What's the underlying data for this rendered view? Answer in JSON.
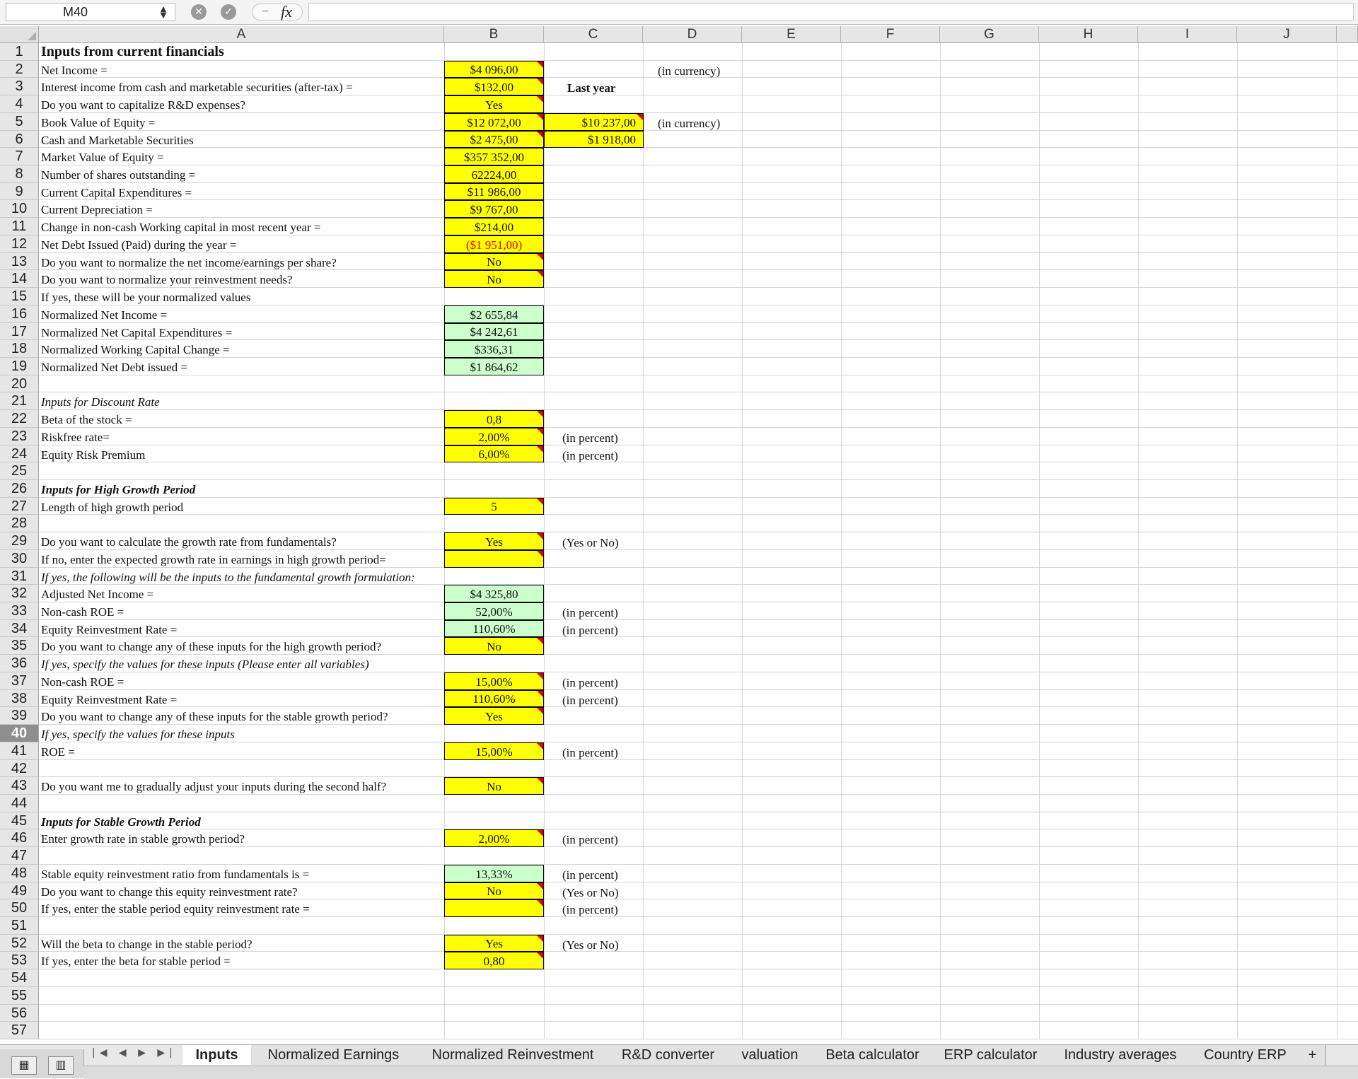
{
  "formula_bar": {
    "name_box": "M40",
    "fx": "fx"
  },
  "columns": [
    "A",
    "B",
    "C",
    "D",
    "E",
    "F",
    "G",
    "H",
    "I",
    "J"
  ],
  "rows": [
    {
      "n": "1",
      "a": "Inputs from current financials",
      "style": "bold"
    },
    {
      "n": "2",
      "a": "Net Income =",
      "b": "$4 096,00",
      "b_mark": true,
      "d": "(in currency)"
    },
    {
      "n": "3",
      "a": "Interest income from cash and marketable securities (after-tax) =",
      "b": "$132,00",
      "b_mark": true,
      "c_label": "Last year"
    },
    {
      "n": "4",
      "a": "Do you want to capitalize R&D expenses?",
      "b": "Yes",
      "b_mark": true
    },
    {
      "n": "5",
      "a": "Book Value of Equity =",
      "b": "$12 072,00",
      "b_mark": true,
      "c": "$10 237,00",
      "c_mark": true,
      "d": "(in currency)"
    },
    {
      "n": "6",
      "a": "Cash and Marketable Securities",
      "b": "$2 475,00",
      "b_mark": true,
      "c": "$1 918,00"
    },
    {
      "n": "7",
      "a": "Market Value of Equity =",
      "b": "$357 352,00"
    },
    {
      "n": "8",
      "a": "Number of shares outstanding =",
      "b": "62224,00"
    },
    {
      "n": "9",
      "a": "Current Capital Expenditures =",
      "b": "$11 986,00"
    },
    {
      "n": "10",
      "a": "Current Depreciation =",
      "b": "$9 767,00"
    },
    {
      "n": "11",
      "a": "Change in non-cash Working capital in most recent year =",
      "b": "$214,00"
    },
    {
      "n": "12",
      "a": "Net Debt Issued (Paid) during the year =",
      "b": "($1 951,00)",
      "b_red": true
    },
    {
      "n": "13",
      "a": "Do you want to normalize the net income/earnings per share?",
      "b": "No",
      "b_mark": true
    },
    {
      "n": "14",
      "a": "Do you want to normalize your reinvestment needs?",
      "b": "No",
      "b_mark": true
    },
    {
      "n": "15",
      "a": "If yes, these will be your normalized values"
    },
    {
      "n": "16",
      "a": "Normalized Net Income =",
      "b": "$2 655,84",
      "b_green": true
    },
    {
      "n": "17",
      "a": "Normalized Net Capital Expenditures =",
      "b": "$4 242,61",
      "b_green": true
    },
    {
      "n": "18",
      "a": "Normalized Working Capital Change =",
      "b": "$336,31",
      "b_green": true
    },
    {
      "n": "19",
      "a": "Normalized Net Debt issued =",
      "b": "$1 864,62",
      "b_green": true
    },
    {
      "n": "20"
    },
    {
      "n": "21",
      "a": "Inputs for Discount Rate",
      "style": "ital"
    },
    {
      "n": "22",
      "a": "Beta of the stock =",
      "b": "0,8",
      "b_mark": true
    },
    {
      "n": "23",
      "a": "Riskfree rate=",
      "b": "2,00%",
      "b_mark": true,
      "c": "(in percent)",
      "c_note": true
    },
    {
      "n": "24",
      "a": "Equity Risk Premium",
      "b": "6,00%",
      "b_mark": true,
      "c": "(in percent)",
      "c_note": true
    },
    {
      "n": "25"
    },
    {
      "n": "26",
      "a": "Inputs for High Growth Period",
      "style": "bi"
    },
    {
      "n": "27",
      "a": "Length of high growth period",
      "b": "5",
      "b_mark": true
    },
    {
      "n": "28"
    },
    {
      "n": "29",
      "a": "Do you want to calculate the growth rate from fundamentals?",
      "b": "Yes",
      "b_mark": true,
      "c": "(Yes or No)",
      "c_note": true
    },
    {
      "n": "30",
      "a": "If no, enter the expected growth rate in earnings in high growth period=",
      "b": "",
      "b_mark": true
    },
    {
      "n": "31",
      "a": "If yes, the following will be the inputs to the fundamental growth formulation:",
      "style": "ital"
    },
    {
      "n": "32",
      "a": "Adjusted Net Income =",
      "b": "$4 325,80",
      "b_green": true
    },
    {
      "n": "33",
      "a": "Non-cash ROE =",
      "b": "52,00%",
      "b_green": true,
      "c": "(in percent)",
      "c_note": true
    },
    {
      "n": "34",
      "a": "Equity Reinvestment Rate =",
      "b": "110,60%",
      "b_green": true,
      "c": "(in percent)",
      "c_note": true
    },
    {
      "n": "35",
      "a": "Do you want to change any of these inputs for the high growth period?",
      "b": "No",
      "b_mark": true
    },
    {
      "n": "36",
      "a": "If yes, specify the values for these inputs (Please enter all variables)",
      "style": "ital"
    },
    {
      "n": "37",
      "a": "Non-cash ROE =",
      "b": "15,00%",
      "b_mark": true,
      "c": "(in percent)",
      "c_note": true
    },
    {
      "n": "38",
      "a": "Equity Reinvestment Rate =",
      "b": "110,60%",
      "b_mark": true,
      "c": "(in percent)",
      "c_note": true
    },
    {
      "n": "39",
      "a": "Do you want to change any of these inputs for the stable growth period?",
      "b": "Yes",
      "b_mark": true
    },
    {
      "n": "40",
      "a": "If yes, specify the values for these inputs",
      "style": "ital",
      "active": true
    },
    {
      "n": "41",
      "a": "ROE =",
      "b": "15,00%",
      "b_mark": true,
      "c": "(in percent)",
      "c_note": true
    },
    {
      "n": "42"
    },
    {
      "n": "43",
      "a": "Do you want me to gradually adjust your inputs during the second half?",
      "b": "No",
      "b_mark": true
    },
    {
      "n": "44"
    },
    {
      "n": "45",
      "a": "Inputs for Stable Growth Period",
      "style": "bi"
    },
    {
      "n": "46",
      "a": "Enter growth rate in stable growth period?",
      "b": "2,00%",
      "b_mark": true,
      "c": "(in percent)",
      "c_note": true
    },
    {
      "n": "47"
    },
    {
      "n": "48",
      "a": "Stable equity reinvestment ratio from fundamentals is =",
      "b": "13,33%",
      "b_green": true,
      "c": "(in percent)",
      "c_note": true
    },
    {
      "n": "49",
      "a": "Do you want to change this equity reinvestment rate?",
      "b": "No",
      "b_mark": true,
      "c": "(Yes or No)",
      "c_note": true
    },
    {
      "n": "50",
      "a": "If yes, enter the stable period equity reinvestment rate =",
      "b": "",
      "b_mark": true,
      "c": "(in percent)",
      "c_note": true
    },
    {
      "n": "51"
    },
    {
      "n": "52",
      "a": "Will the beta to change in the stable period?",
      "b": "Yes",
      "b_mark": true,
      "c": "(Yes or No)",
      "c_note": true
    },
    {
      "n": "53",
      "a": "If yes, enter the beta for stable period =",
      "b": "0,80",
      "b_mark": true
    },
    {
      "n": "54"
    },
    {
      "n": "55"
    },
    {
      "n": "56"
    },
    {
      "n": "57"
    }
  ],
  "tabs": [
    "Inputs",
    "Normalized Earnings",
    "Normalized Reinvestment",
    "R&D converter",
    "valuation",
    "Beta calculator",
    "ERP calculator",
    "Industry averages",
    "Country ERP",
    "+"
  ],
  "active_tab": "Inputs",
  "colors": {
    "input_yellow": "#ffff00",
    "calc_green": "#ccffcc",
    "marker_red": "#e00000"
  }
}
